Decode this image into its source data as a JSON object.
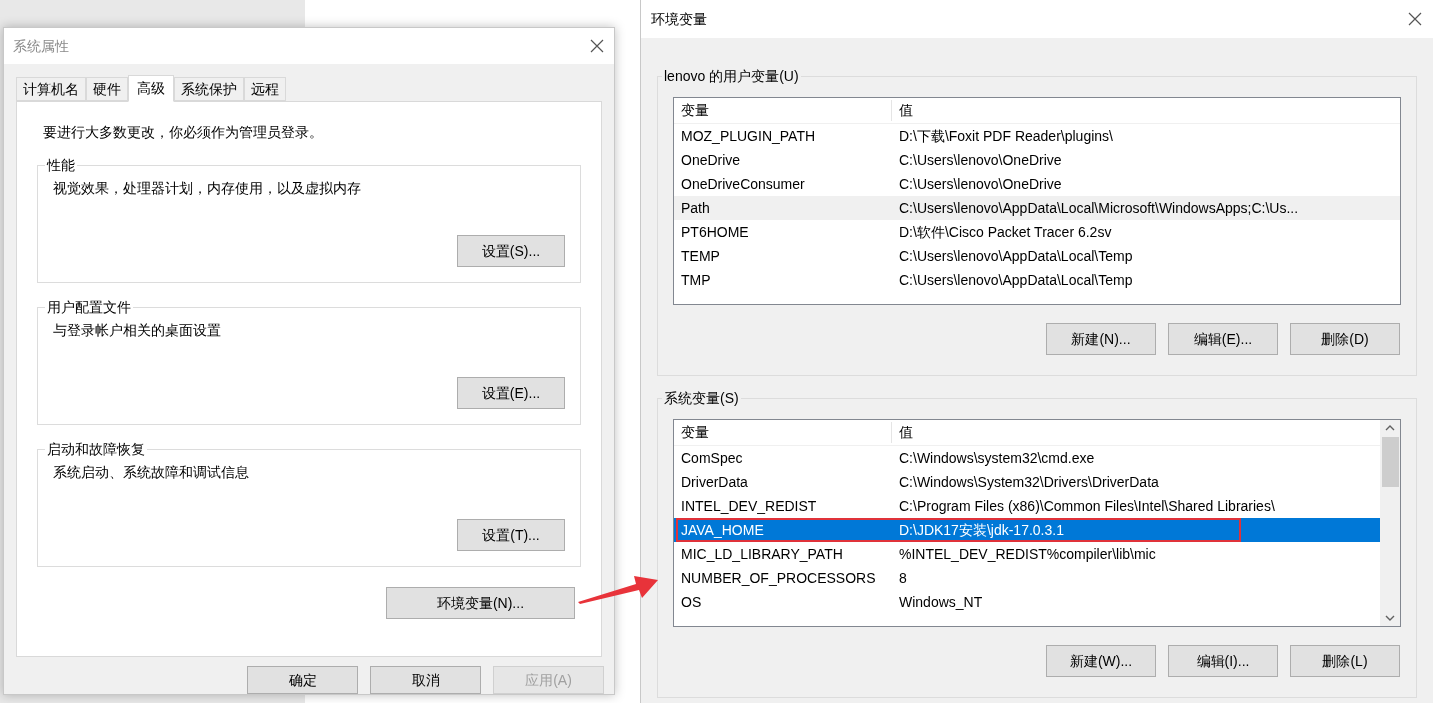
{
  "system_properties": {
    "title": "系统属性",
    "tabs": [
      {
        "label": "计算机名",
        "selected": false
      },
      {
        "label": "硬件",
        "selected": false
      },
      {
        "label": "高级",
        "selected": true
      },
      {
        "label": "系统保护",
        "selected": false
      },
      {
        "label": "远程",
        "selected": false
      }
    ],
    "notice": "要进行大多数更改，你必须作为管理员登录。",
    "groups": [
      {
        "title": "性能",
        "description": "视觉效果，处理器计划，内存使用，以及虚拟内存",
        "button": "设置(S)..."
      },
      {
        "title": "用户配置文件",
        "description": "与登录帐户相关的桌面设置",
        "button": "设置(E)..."
      },
      {
        "title": "启动和故障恢复",
        "description": "系统启动、系统故障和调试信息",
        "button": "设置(T)..."
      }
    ],
    "env_button": "环境变量(N)...",
    "footer_buttons": [
      {
        "label": "确定",
        "disabled": false
      },
      {
        "label": "取消",
        "disabled": false
      },
      {
        "label": "应用(A)",
        "disabled": true
      }
    ]
  },
  "environment_variables": {
    "title": "环境变量",
    "sections": [
      {
        "title": "lenovo 的用户变量(U)",
        "focused": false,
        "scrollbar": false,
        "columns": [
          "变量",
          "值"
        ],
        "rows": [
          {
            "name": "MOZ_PLUGIN_PATH",
            "value": "D:\\下载\\Foxit PDF Reader\\plugins\\",
            "selected": false,
            "highlighted": false
          },
          {
            "name": "OneDrive",
            "value": "C:\\Users\\lenovo\\OneDrive",
            "selected": false,
            "highlighted": false
          },
          {
            "name": "OneDriveConsumer",
            "value": "C:\\Users\\lenovo\\OneDrive",
            "selected": false,
            "highlighted": false
          },
          {
            "name": "Path",
            "value": "C:\\Users\\lenovo\\AppData\\Local\\Microsoft\\WindowsApps;C:\\Us...",
            "selected": true,
            "highlighted": false
          },
          {
            "name": "PT6HOME",
            "value": "D:\\软件\\Cisco Packet Tracer 6.2sv",
            "selected": false,
            "highlighted": false
          },
          {
            "name": "TEMP",
            "value": "C:\\Users\\lenovo\\AppData\\Local\\Temp",
            "selected": false,
            "highlighted": false
          },
          {
            "name": "TMP",
            "value": "C:\\Users\\lenovo\\AppData\\Local\\Temp",
            "selected": false,
            "highlighted": false
          }
        ],
        "buttons": [
          "新建(N)...",
          "编辑(E)...",
          "删除(D)"
        ]
      },
      {
        "title": "系统变量(S)",
        "focused": true,
        "scrollbar": true,
        "columns": [
          "变量",
          "值"
        ],
        "rows": [
          {
            "name": "ComSpec",
            "value": "C:\\Windows\\system32\\cmd.exe",
            "selected": false,
            "highlighted": false
          },
          {
            "name": "DriverData",
            "value": "C:\\Windows\\System32\\Drivers\\DriverData",
            "selected": false,
            "highlighted": false
          },
          {
            "name": "INTEL_DEV_REDIST",
            "value": "C:\\Program Files (x86)\\Common Files\\Intel\\Shared Libraries\\",
            "selected": false,
            "highlighted": false
          },
          {
            "name": "JAVA_HOME",
            "value": "D:\\JDK17安装\\jdk-17.0.3.1",
            "selected": true,
            "highlighted": true
          },
          {
            "name": "MIC_LD_LIBRARY_PATH",
            "value": "%INTEL_DEV_REDIST%compiler\\lib\\mic",
            "selected": false,
            "highlighted": false
          },
          {
            "name": "NUMBER_OF_PROCESSORS",
            "value": "8",
            "selected": false,
            "highlighted": false
          },
          {
            "name": "OS",
            "value": "Windows_NT",
            "selected": false,
            "highlighted": false
          }
        ],
        "buttons": [
          "新建(W)...",
          "编辑(I)...",
          "删除(L)"
        ]
      }
    ]
  }
}
